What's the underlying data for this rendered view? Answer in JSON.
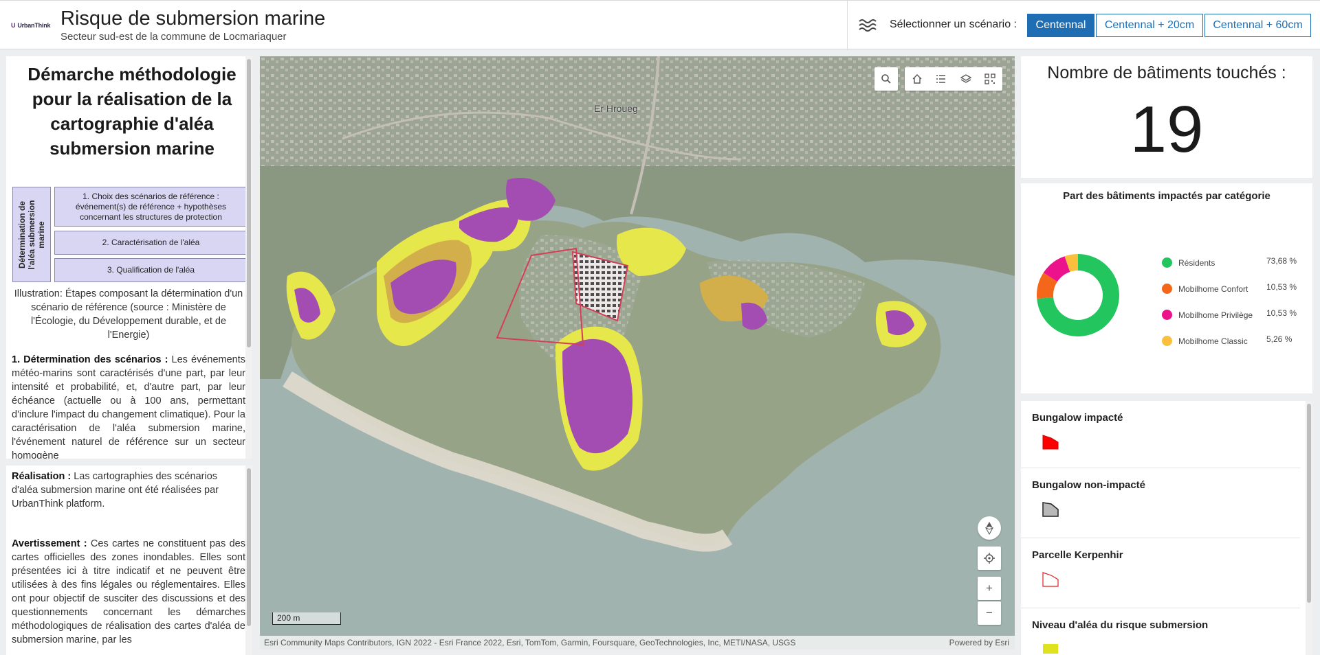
{
  "header": {
    "logo": "UrbanThink",
    "title": "Risque de submersion marine",
    "subtitle": "Secteur sud-est de la commune de Locmariaquer",
    "scenario_label": "Sélectionner un scénario :",
    "scenarios": [
      "Centennal",
      "Centennal + 20cm",
      "Centennal + 60cm"
    ],
    "active_scenario": "Centennal",
    "colors": {
      "accent": "#1f6eb4"
    }
  },
  "left_panel": {
    "method_title": "Démarche méthodologie pour la réalisation de la cartographie  d'aléa submersion marine",
    "diagram": {
      "vertical_label": "Détermination de l'aléa submersion marine",
      "steps": [
        "1. Choix des scénarios de référence : événement(s) de référence +  hypothèses concernant les structures de protection",
        "2. Caractérisation de l'aléa",
        "3. Qualification de l'aléa"
      ]
    },
    "illustration": "Illustration: Étapes composant la détermination d'un scénario de référence (source : Ministère de l'Écologie, du Développement durable, et de l'Energie)",
    "section1_title": "1. Détermination des scénarios :",
    "section1_text": " Les événements météo-marins sont caractérisés d'une part, par leur intensité et probabilité, et, d'autre part, par leur échéance (actuelle ou à 100 ans, permettant d'inclure l'impact du changement climatique). Pour la caractérisation de l'aléa submersion marine, l'événement naturel de référence sur un secteur homogène",
    "realisation_title": "Réalisation :",
    "realisation_text": " Las cartographies des scénarios d'aléa submersion marine ont  été réalisées par UrbanThink platform.",
    "warning_title": "Avertissement :",
    "warning_text": " Ces cartes ne constituent pas des cartes officielles des zones inondables. Elles sont présentées ici à titre indicatif et ne peuvent être utilisées à des fins légales ou réglementaires. Elles ont pour objectif de susciter des discussions et des questionnements concernant les démarches méthodologiques de réalisation des cartes d'aléa de submersion marine, par les"
  },
  "map": {
    "place_label": "Er Hroueg",
    "scale_label": "200 m",
    "attribution": "Esri Community Maps Contributors, IGN 2022 - Esri France 2022, Esri, TomTom, Garmin, Foursquare, GeoTechnologies, Inc, METI/NASA, USGS",
    "powered_by": "Powered by Esri",
    "tools": [
      "search-icon",
      "home-icon",
      "list-icon",
      "layers-icon",
      "qr-icon"
    ],
    "nav": [
      "compass-icon",
      "locate-icon",
      "zoom-in-icon",
      "zoom-out-icon"
    ],
    "zoom_in_label": "+",
    "zoom_out_label": "−"
  },
  "stats": {
    "count_title": "Nombre de bâtiments touchés :",
    "count_value": "19"
  },
  "chart_data": {
    "type": "pie",
    "title": "Part des bâtiments impactés par catégorie",
    "categories": [
      "Résidents",
      "Mobilhome Confort",
      "Mobilhome Privilège",
      "Mobilhome Classic"
    ],
    "values": [
      73.68,
      10.53,
      10.53,
      5.26
    ],
    "labels": [
      "73,68 %",
      "10,53 %",
      "10,53 %",
      "5,26 %"
    ],
    "colors": [
      "#22c55e",
      "#f4661a",
      "#ec128c",
      "#fbbf3e"
    ],
    "legend_position": "right",
    "donut": true
  },
  "legend": {
    "items": [
      {
        "title": "Bungalow impacté",
        "symbol": "red-polygon"
      },
      {
        "title": "Bungalow non-impacté",
        "symbol": "grey-polygon"
      },
      {
        "title": "Parcelle Kerpenhir",
        "symbol": "red-outline-polygon"
      },
      {
        "title": "Niveau d'aléa du risque submersion",
        "symbol": "hazard-swatch"
      }
    ]
  }
}
